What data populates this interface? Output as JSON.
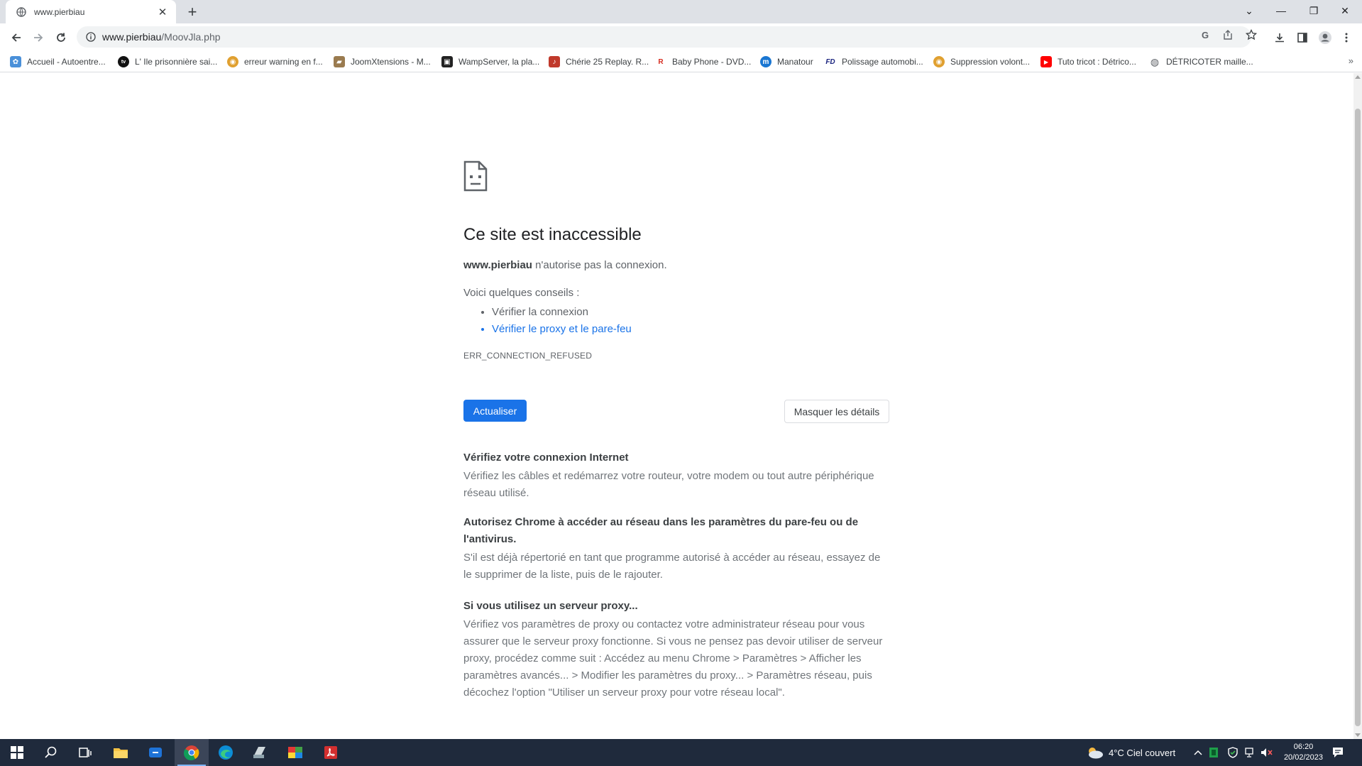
{
  "tab": {
    "title": "www.pierbiau",
    "close": "✕",
    "new_tab": "+"
  },
  "window_controls": {
    "minimize": "—",
    "restore": "❐",
    "close": "✕",
    "tabsearch": "⌄"
  },
  "address_bar": {
    "host": "www.pierbiau",
    "path": "/MoovJla.php"
  },
  "bookmarks": [
    {
      "label": "Accueil - Autoentre...",
      "icon_color": "#4a90d9",
      "glyph": "✿"
    },
    {
      "label": "L' Ile prisonnière sai...",
      "icon_color": "#111111",
      "glyph": "tv"
    },
    {
      "label": "erreur warning en f...",
      "icon_color": "#e0a030",
      "glyph": "◉"
    },
    {
      "label": "JoomXtensions - M...",
      "icon_color": "#9a7b4f",
      "glyph": "▰"
    },
    {
      "label": "WampServer, la pla...",
      "icon_color": "#222222",
      "glyph": "▣"
    },
    {
      "label": "Chérie 25 Replay. R...",
      "icon_color": "#c0392b",
      "glyph": "♪"
    },
    {
      "label": "Baby Phone - DVD...",
      "icon_color": "#d62d20",
      "glyph": "R"
    },
    {
      "label": "Manatour",
      "icon_color": "#1976d2",
      "glyph": "m"
    },
    {
      "label": "Polissage automobi...",
      "icon_color": "#1a237e",
      "glyph": "FD"
    },
    {
      "label": "Suppression volont...",
      "icon_color": "#e0a030",
      "glyph": "◉"
    },
    {
      "label": "Tuto tricot : Détrico...",
      "icon_color": "#ff0000",
      "glyph": "▶"
    },
    {
      "label": "DÉTRICOTER maille...",
      "icon_color": "#5f6368",
      "glyph": "◍"
    }
  ],
  "bookmarks_more": "»",
  "error": {
    "title": "Ce site est inaccessible",
    "host": "www.pierbiau",
    "message": "n'autorise pas la connexion.",
    "tips_heading": "Voici quelques conseils :",
    "tips": [
      "Vérifier la connexion",
      "Vérifier le proxy et le pare-feu"
    ],
    "code": "ERR_CONNECTION_REFUSED",
    "reload_label": "Actualiser",
    "details_label": "Masquer les détails"
  },
  "details": [
    {
      "heading": "Vérifiez votre connexion Internet",
      "body": "Vérifiez les câbles et redémarrez votre routeur, votre modem ou tout autre périphérique réseau utilisé."
    },
    {
      "heading": "Autorisez Chrome à accéder au réseau dans les paramètres du pare-feu ou de l'antivirus.",
      "body": "S'il est déjà répertorié en tant que programme autorisé à accéder au réseau, essayez de le supprimer de la liste, puis de le rajouter."
    },
    {
      "heading": "Si vous utilisez un serveur proxy...",
      "body": "Vérifiez vos paramètres de proxy ou contactez votre administrateur réseau pour vous assurer que le serveur proxy fonctionne. Si vous ne pensez pas devoir utiliser de serveur proxy, procédez comme suit : Accédez au menu Chrome > Paramètres > Afficher les paramètres avancés... > Modifier les paramètres du proxy... > Paramètres réseau, puis décochez l'option \"Utiliser un serveur proxy pour votre réseau local\"."
    }
  ],
  "taskbar": {
    "weather": "4°C  Ciel couvert",
    "time": "06:20",
    "date": "20/02/2023"
  }
}
